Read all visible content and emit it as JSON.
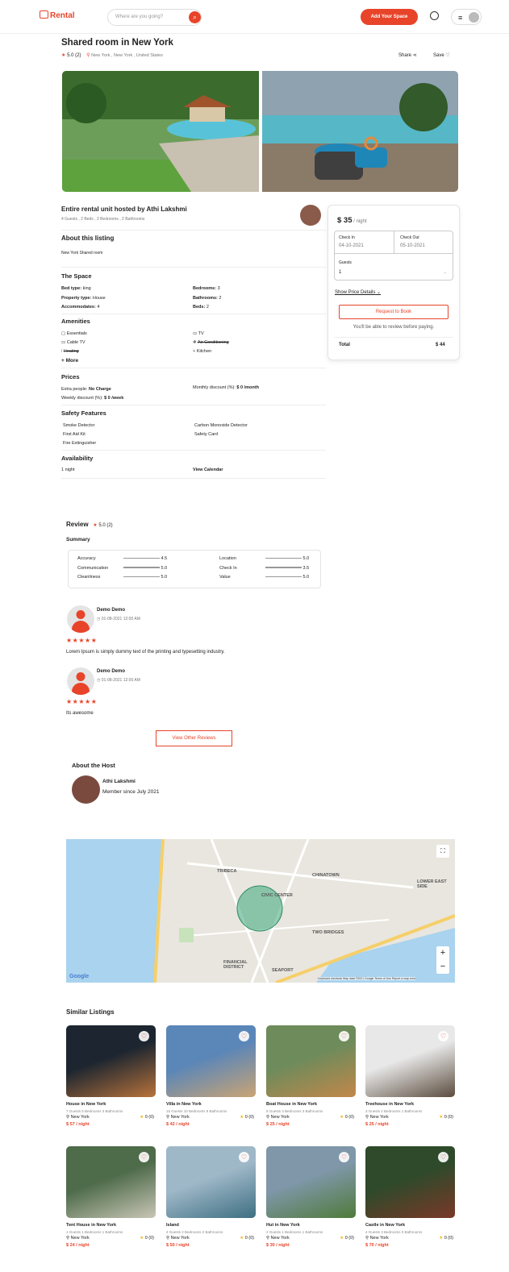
{
  "header": {
    "logo": "Rental",
    "search_placeholder": "Where are you going?",
    "add_space": "Add Your Space"
  },
  "listing": {
    "title": "Shared room in New York",
    "rating": "5.0 (2)",
    "location": "New York , New York , United States",
    "share": "Share",
    "save": "Save"
  },
  "host_line": {
    "title": "Entire rental unit hosted by Athi Lakshmi",
    "meta": "4 Guests , 2 Beds , 3 Bedrooms , 2 Bathrooms"
  },
  "about": {
    "title": "About this listing",
    "text": "New York Shared room"
  },
  "space": {
    "title": "The Space",
    "left": [
      {
        "k": "Bed type:",
        "v": "king"
      },
      {
        "k": "Property type:",
        "v": "House"
      },
      {
        "k": "Accommodates:",
        "v": "4"
      }
    ],
    "right": [
      {
        "k": "Bedrooms:",
        "v": "3"
      },
      {
        "k": "Bathrooms:",
        "v": "2"
      },
      {
        "k": "Beds:",
        "v": "2"
      }
    ]
  },
  "amenities": {
    "title": "Amenities",
    "left": [
      "Essentials",
      "Cable TV",
      "Heating"
    ],
    "right": [
      "TV",
      "Air Conditioning",
      "Kitchen"
    ],
    "more": "+ More"
  },
  "prices": {
    "title": "Prices",
    "extra_k": "Extra people:",
    "extra_v": "No Charge",
    "weekly_k": "Weekly discount (%):",
    "weekly_v": "$ 0 /week",
    "monthly_k": "Monthly discount (%):",
    "monthly_v": "$ 0 /month"
  },
  "safety": {
    "title": "Safety Features",
    "left": [
      "Smoke Detector",
      "First Aid Kit",
      "Fire Extinguisher"
    ],
    "right": [
      "Carbon Monoxide Detector",
      "Safety Card"
    ]
  },
  "availability": {
    "title": "Availability",
    "nights": "1 night",
    "calendar": "View Calendar"
  },
  "booking": {
    "price": "$ 35",
    "per": "/ night",
    "checkin_label": "Check In",
    "checkin": "04-10-2021",
    "checkout_label": "Check Out",
    "checkout": "05-10-2021",
    "guests_label": "Guests",
    "guests": "1",
    "price_details": "Show Price Details",
    "request": "Request to Book",
    "note": "You'll be able to review before paying.",
    "total_label": "Total",
    "total": "$ 44"
  },
  "review": {
    "title": "Review",
    "rating": "5.0 (2)",
    "summary": "Summary",
    "left": [
      {
        "k": "Accuracy",
        "v": "4.5"
      },
      {
        "k": "Communication",
        "v": "5.0"
      },
      {
        "k": "Cleanliness",
        "v": "5.0"
      }
    ],
    "right": [
      {
        "k": "Location",
        "v": "5.0"
      },
      {
        "k": "Check In",
        "v": "3.5"
      },
      {
        "k": "Value",
        "v": "5.0"
      }
    ],
    "items": [
      {
        "name": "Demo Demo",
        "date": "01-08-2021 12:00 AM",
        "stars": "★★★★★",
        "text": "Lorem Ipsum is simply dummy text of the printing and typesetting industry."
      },
      {
        "name": "Demo Demo",
        "date": "01-08-2021 12:00 AM",
        "stars": "★★★★★",
        "text": "Its awesome"
      }
    ],
    "other": "View Other Reviews"
  },
  "host": {
    "title": "About the Host",
    "name": "Athi Lakshmi",
    "since": "Member since July 2021"
  },
  "map": {
    "labels": [
      "TRIBECA",
      "CHINATOWN",
      "CIVIC CENTER",
      "TWO BRIDGES",
      "FINANCIAL DISTRICT",
      "SEAPORT",
      "LOWER EAST SIDE"
    ],
    "google": "Google",
    "footer": "Keyboard shortcuts  Map data ©2021 Google  Terms of Use  Report a map error"
  },
  "similar": {
    "title": "Similar Listings",
    "items": [
      {
        "name": "House in New York",
        "meta": "7 Guests  5 Bedrooms  3 Bathrooms",
        "loc": "New York",
        "rating": "0 (0)",
        "price": "$ 57 / night",
        "c1": "#1c2530",
        "c2": "#b8733b"
      },
      {
        "name": "Villa in New York",
        "meta": "15 Guests  10 Bedrooms  8 Bathrooms",
        "loc": "New York",
        "rating": "0 (0)",
        "price": "$ 42 / night",
        "c1": "#5b86b8",
        "c2": "#caa474"
      },
      {
        "name": "Boat House in New York",
        "meta": "5 Guests  3 Bedrooms  3 Bathrooms",
        "loc": "New York",
        "rating": "0 (0)",
        "price": "$ 25 / night",
        "c1": "#6e8b5b",
        "c2": "#c2874a"
      },
      {
        "name": "Treehouse in New York",
        "meta": "3 Guests  2 Bedrooms  1 Bathrooms",
        "loc": "New York",
        "rating": "0 (0)",
        "price": "$ 25 / night",
        "c1": "#e8e8e8",
        "c2": "#5b4c3e"
      },
      {
        "name": "Tent House in New York",
        "meta": "1 Guests  1 Bedrooms  1 Bathrooms",
        "loc": "New York",
        "rating": "0 (0)",
        "price": "$ 24 / night",
        "c1": "#4e6b4a",
        "c2": "#c9c6b6"
      },
      {
        "name": "Island",
        "meta": "4 Guests  2 Bedrooms  2 Bathrooms",
        "loc": "New York",
        "rating": "0 (0)",
        "price": "$ 50 / night",
        "c1": "#9fb8c8",
        "c2": "#3d6f82"
      },
      {
        "name": "Hut in New York",
        "meta": "2 Guests  1 Bedrooms  1 Bathrooms",
        "loc": "New York",
        "rating": "0 (0)",
        "price": "$ 30 / night",
        "c1": "#7f97a8",
        "c2": "#4f7a3a"
      },
      {
        "name": "Castle in New York",
        "meta": "4 Guests  3 Bedrooms  3 Bathrooms",
        "loc": "New York",
        "rating": "0 (0)",
        "price": "$ 70 / night",
        "c1": "#2e4a2a",
        "c2": "#7a3828"
      }
    ]
  },
  "colors": {
    "accent": "#e8442a",
    "star": "#f5b50a"
  }
}
